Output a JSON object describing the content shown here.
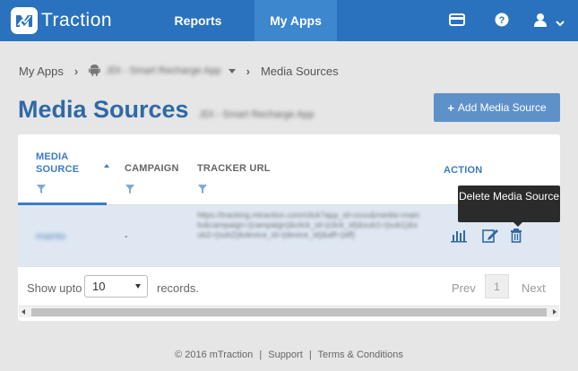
{
  "app": {
    "logo_text": "Traction",
    "brand_color": "#2a72bd"
  },
  "nav": {
    "reports": "Reports",
    "my_apps": "My Apps"
  },
  "icons": {
    "billing": "credit-card-icon",
    "help": "help-icon",
    "user": "user-icon",
    "chevron": "chevron-down-icon"
  },
  "breadcrumb": {
    "root": "My Apps",
    "app_name": "JDI - Smart Recharge App",
    "current": "Media Sources"
  },
  "page": {
    "title": "Media Sources",
    "subtitle": "JDI - Smart Recharge App",
    "add_button": "Add Media Source",
    "add_icon": "+"
  },
  "table": {
    "headers": {
      "media_source_line1": "MEDIA",
      "media_source_line2": "SOURCE",
      "campaign": "CAMPAIGN",
      "tracker_url": "TRACKER URL",
      "action": "ACTION"
    },
    "rows": [
      {
        "media_source": "mainto",
        "campaign": "-",
        "tracker_url": "https://tracking.mtraction.com/click?app_id=xxxx&media=mainto&campaign={campaign}&click_id={click_id}&sub1={sub1}&sub2={sub2}&device_id={device_id}&aff={aff}"
      }
    ],
    "tooltip": "Delete Media Source"
  },
  "pagination": {
    "show_upto": "Show upto",
    "records": "records.",
    "page_size": "10",
    "prev": "Prev",
    "page": "1",
    "next": "Next"
  },
  "footer": {
    "copyright": "© 2016 mTraction",
    "support": "Support",
    "terms": "Terms & Conditions",
    "separator": "|"
  }
}
